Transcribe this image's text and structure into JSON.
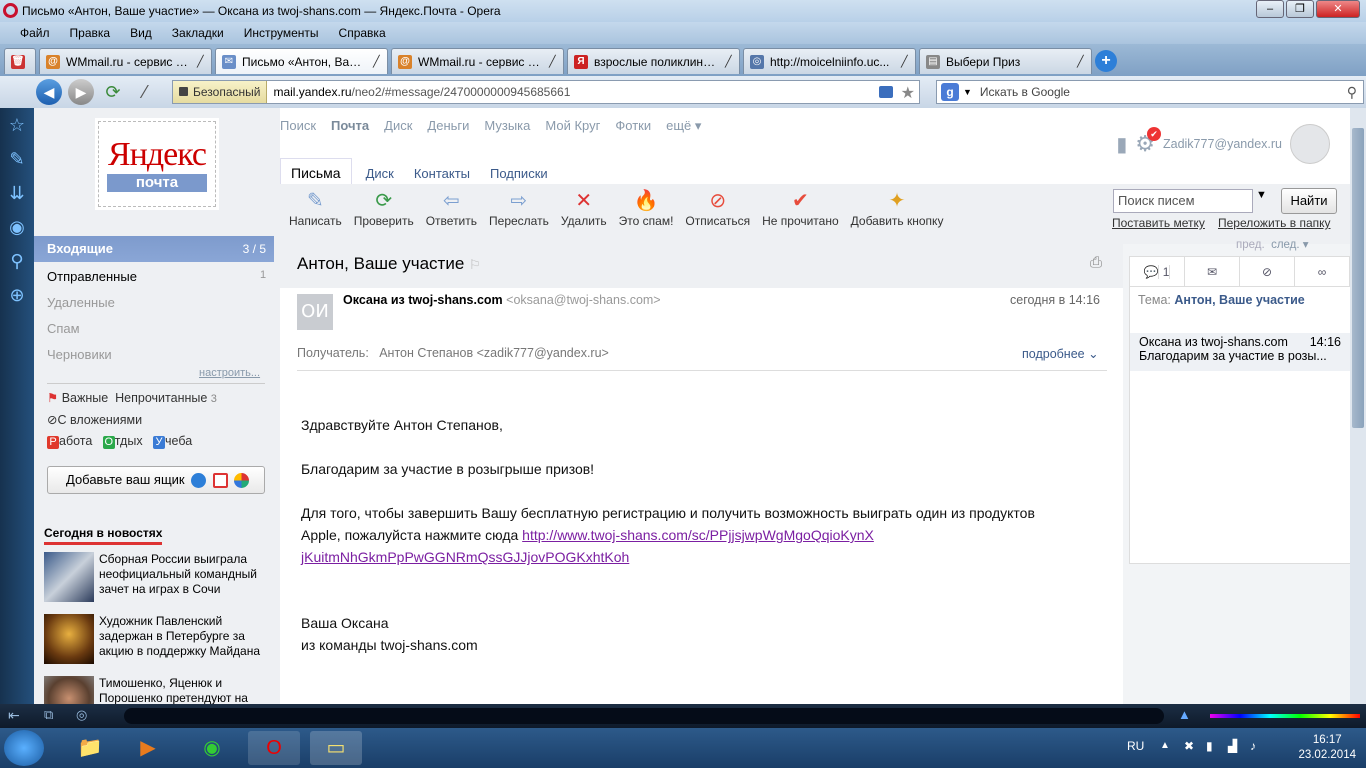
{
  "window": {
    "title": "Письмо «Антон, Ваше участие» — Оксана из twoj-shans.com — Яндекс.Почта - Opera"
  },
  "menu": [
    "Файл",
    "Правка",
    "Вид",
    "Закладки",
    "Инструменты",
    "Справка"
  ],
  "tabs": [
    {
      "label": "WMmail.ru - сервис п...",
      "icon": "wmmail-icon",
      "color": "#d9822b"
    },
    {
      "label": "Письмо «Антон, Ваш...",
      "icon": "mail-icon",
      "color": "#6a8fc8"
    },
    {
      "label": "WMmail.ru - сервис п...",
      "icon": "wmmail-icon",
      "color": "#d9822b"
    },
    {
      "label": "взрослые поликлинн...",
      "icon": "yandex-icon",
      "color": "#cc2222"
    },
    {
      "label": "http://moicelniinfo.uc...",
      "icon": "globe-icon",
      "color": "#5577aa"
    },
    {
      "label": "Выбери Приз",
      "icon": "page-icon",
      "color": "#888888"
    }
  ],
  "address": {
    "secure_label": "Безопасный",
    "domain": "mail.yandex.ru",
    "path": "/neo2/#message/2470000000945685661"
  },
  "search": {
    "placeholder": "Искать в Google",
    "engine_letter": "g"
  },
  "logo": {
    "brand": "Яндекс",
    "service": "почта"
  },
  "folders": {
    "inbox": {
      "label": "Входящие",
      "count": "3 / 5"
    },
    "sent": {
      "label": "Отправленные",
      "count": "1"
    },
    "deleted": "Удаленные",
    "spam": "Спам",
    "drafts": "Черновики",
    "configure": "настроить..."
  },
  "filters": {
    "important": "Важные",
    "unread": "Непрочитанные",
    "unread_count": "3",
    "attachments": "С вложениями"
  },
  "labels": [
    {
      "letter": "Р",
      "rest": "абота",
      "color": "#e0392c"
    },
    {
      "letter": "О",
      "rest": "тдых",
      "color": "#2aa84a"
    },
    {
      "letter": "У",
      "rest": "чеба",
      "color": "#3a7bd5"
    }
  ],
  "add_mailbox": "Добавьте ваш ящик",
  "news": {
    "heading": "Сегодня в новостях",
    "items": [
      {
        "text": "Сборная России выиграла неофициальный командный зачет на играх в Сочи"
      },
      {
        "text": "Художник Павленский задержан в Петербурге за акцию в поддержку Майдана"
      },
      {
        "text": "Тимошенко, Яценюк и Порошенко претендуют на"
      }
    ]
  },
  "top_nav": [
    "Поиск",
    "Почта",
    "Диск",
    "Деньги",
    "Музыка",
    "Мой Круг",
    "Фотки",
    "ещё ▾"
  ],
  "mail_tabs": [
    "Письма",
    "Диск",
    "Контакты",
    "Подписки"
  ],
  "user": {
    "email": "Zadik777@yandex.ru"
  },
  "toolbar": [
    {
      "label": "Написать",
      "icon": "compose-icon",
      "glyph": "✎"
    },
    {
      "label": "Проверить",
      "icon": "refresh-icon",
      "glyph": "⟳"
    },
    {
      "label": "Ответить",
      "icon": "reply-icon",
      "glyph": "⇦"
    },
    {
      "label": "Переслать",
      "icon": "forward-icon",
      "glyph": "⇨"
    },
    {
      "label": "Удалить",
      "icon": "delete-icon",
      "glyph": "✕"
    },
    {
      "label": "Это спам!",
      "icon": "spam-icon",
      "glyph": "🔥"
    },
    {
      "label": "Отписаться",
      "icon": "unsubscribe-icon",
      "glyph": "⊘"
    },
    {
      "label": "Не прочитано",
      "icon": "unread-icon",
      "glyph": "✔"
    },
    {
      "label": "Добавить кнопку",
      "icon": "magic-wand-icon",
      "glyph": "✦"
    }
  ],
  "find": {
    "placeholder": "Поиск писем",
    "button": "Найти",
    "set_label": "Поставить метку",
    "move": "Переложить в папку"
  },
  "message": {
    "subject": "Антон, Ваше участие",
    "avatar": "ОИ",
    "sender": "Оксана из twoj-shans.com",
    "sender_email": "<oksana@twoj-shans.com>",
    "date": "сегодня в 14:16",
    "recipient_label": "Получатель:",
    "recipient": "Антон Степанов <zadik777@yandex.ru>",
    "more": "подробнее",
    "greeting": "Здравствуйте Антон Степанов,",
    "thanks": "Благодарим за участие в розыгрыше призов!",
    "para1": "Для того, чтобы завершить Вашу бесплатную регистрацию и получить возможность выиграть один из продуктов",
    "para2": "Apple, пожалуйста нажмите сюда ",
    "link1": "http://www.twoj-shans.com/sc/PPjjsjwpWgMgoQqioKynX",
    "link2": "jKuitmNhGkmPpPwGGNRmQssGJJjovPOGKxhtKoh",
    "sign1": "Ваша Оксана",
    "sign2": "из команды twoj-shans.com"
  },
  "thread": {
    "prev": "пред.",
    "next": "след. ▾",
    "count": "1",
    "topic_label": "Тема:",
    "topic": "Антон, Ваше участие",
    "item_sender": "Оксана из twoj-shans.com",
    "item_time": "14:16",
    "item_snippet": "Благодарим за участие в розы..."
  },
  "taskbar": {
    "lang": "RU",
    "time": "16:17",
    "date": "23.02.2014"
  }
}
